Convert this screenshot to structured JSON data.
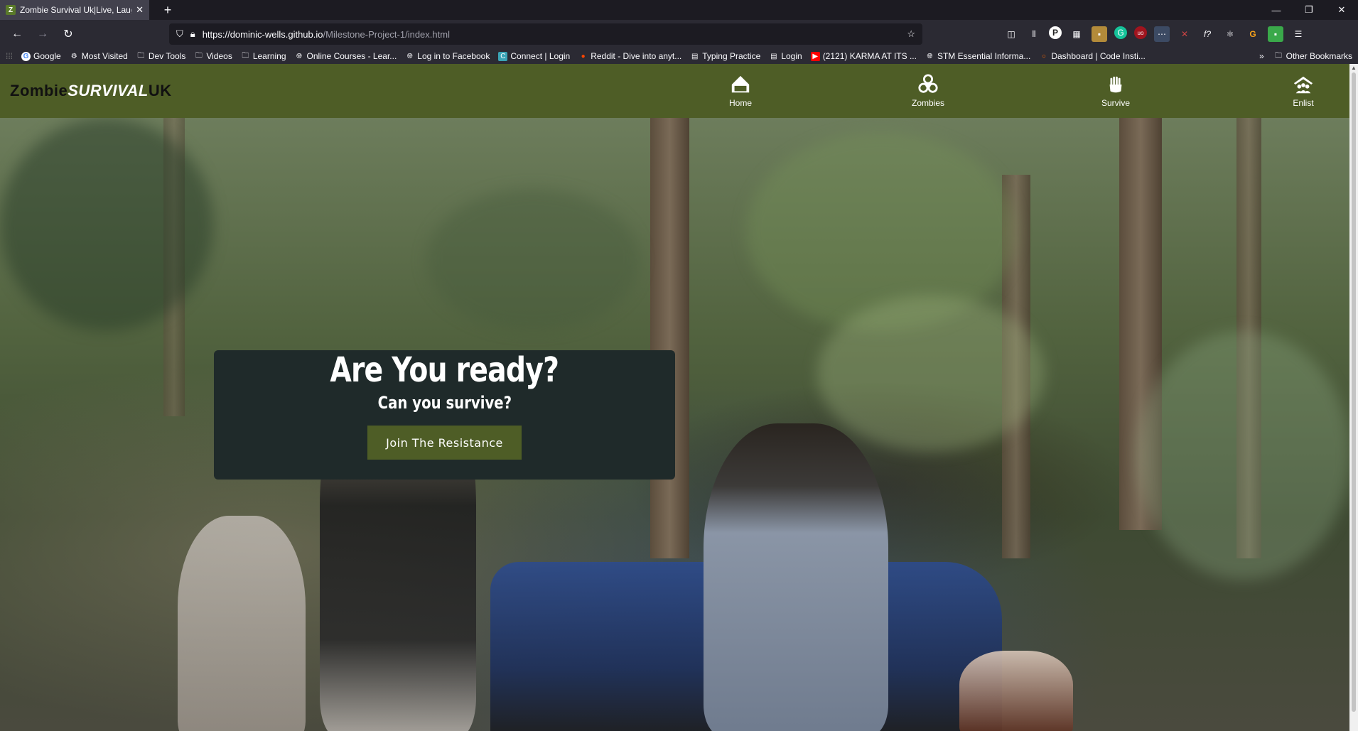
{
  "browser": {
    "tab_title": "Zombie Survival Uk|Live, Laugh",
    "tab_favicon": "Z",
    "url_host": "https://dominic-wells.github.io",
    "url_path": "/Milestone-Project-1/index.html"
  },
  "bookmarks": [
    {
      "label": "Google",
      "icon": "google-icon"
    },
    {
      "label": "Most Visited",
      "icon": "gear-icon"
    },
    {
      "label": "Dev Tools",
      "icon": "folder-icon"
    },
    {
      "label": "Videos",
      "icon": "folder-icon"
    },
    {
      "label": "Learning",
      "icon": "folder-icon"
    },
    {
      "label": "Online Courses - Lear...",
      "icon": "globe-icon"
    },
    {
      "label": "Log in to Facebook",
      "icon": "globe-icon"
    },
    {
      "label": "Connect | Login",
      "icon": "connect-icon"
    },
    {
      "label": "Reddit - Dive into anyt...",
      "icon": "reddit-icon"
    },
    {
      "label": "Typing Practice",
      "icon": "page-icon"
    },
    {
      "label": "Login",
      "icon": "page-icon"
    },
    {
      "label": "(2121) KARMA AT ITS ...",
      "icon": "youtube-icon"
    },
    {
      "label": "STM Essential Informa...",
      "icon": "globe-icon"
    },
    {
      "label": "Dashboard | Code Insti...",
      "icon": "circle-icon"
    }
  ],
  "bookmarks_other": "Other Bookmarks",
  "site": {
    "logo_zombie": "Zombie",
    "logo_survival": "SURVIVAL",
    "logo_uk": "UK",
    "nav": [
      {
        "label": "Home",
        "icon": "home-icon"
      },
      {
        "label": "Zombies",
        "icon": "biohazard-icon"
      },
      {
        "label": "Survive",
        "icon": "hand-icon"
      },
      {
        "label": "Enlist",
        "icon": "team-icon"
      }
    ]
  },
  "hero": {
    "title": "Are You ready?",
    "subtitle": "Can you survive?",
    "button": "Join The Resistance"
  },
  "colors": {
    "header_green": "#4e5d26",
    "card_bg": "#1f2a2a"
  }
}
